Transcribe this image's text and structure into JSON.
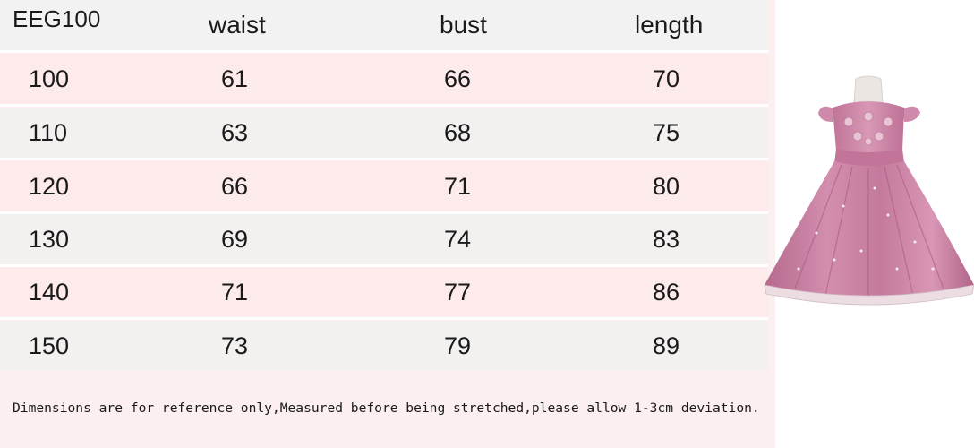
{
  "table": {
    "headers": [
      "EEG100",
      "waist",
      "bust",
      "length"
    ],
    "rows": [
      [
        "100",
        "61",
        "66",
        "70"
      ],
      [
        "110",
        "63",
        "68",
        "75"
      ],
      [
        "120",
        "66",
        "71",
        "80"
      ],
      [
        "130",
        "69",
        "74",
        "83"
      ],
      [
        "140",
        "71",
        "77",
        "86"
      ],
      [
        "150",
        "73",
        "79",
        "89"
      ]
    ]
  },
  "note": "Dimensions are for reference only,Measured before being stretched,please allow 1-3cm deviation.",
  "colors": {
    "header_bg": "#f2f2f2",
    "row_pink": "#fdeaea",
    "row_grey": "#f3f0f0",
    "dress": "#c9809f"
  }
}
